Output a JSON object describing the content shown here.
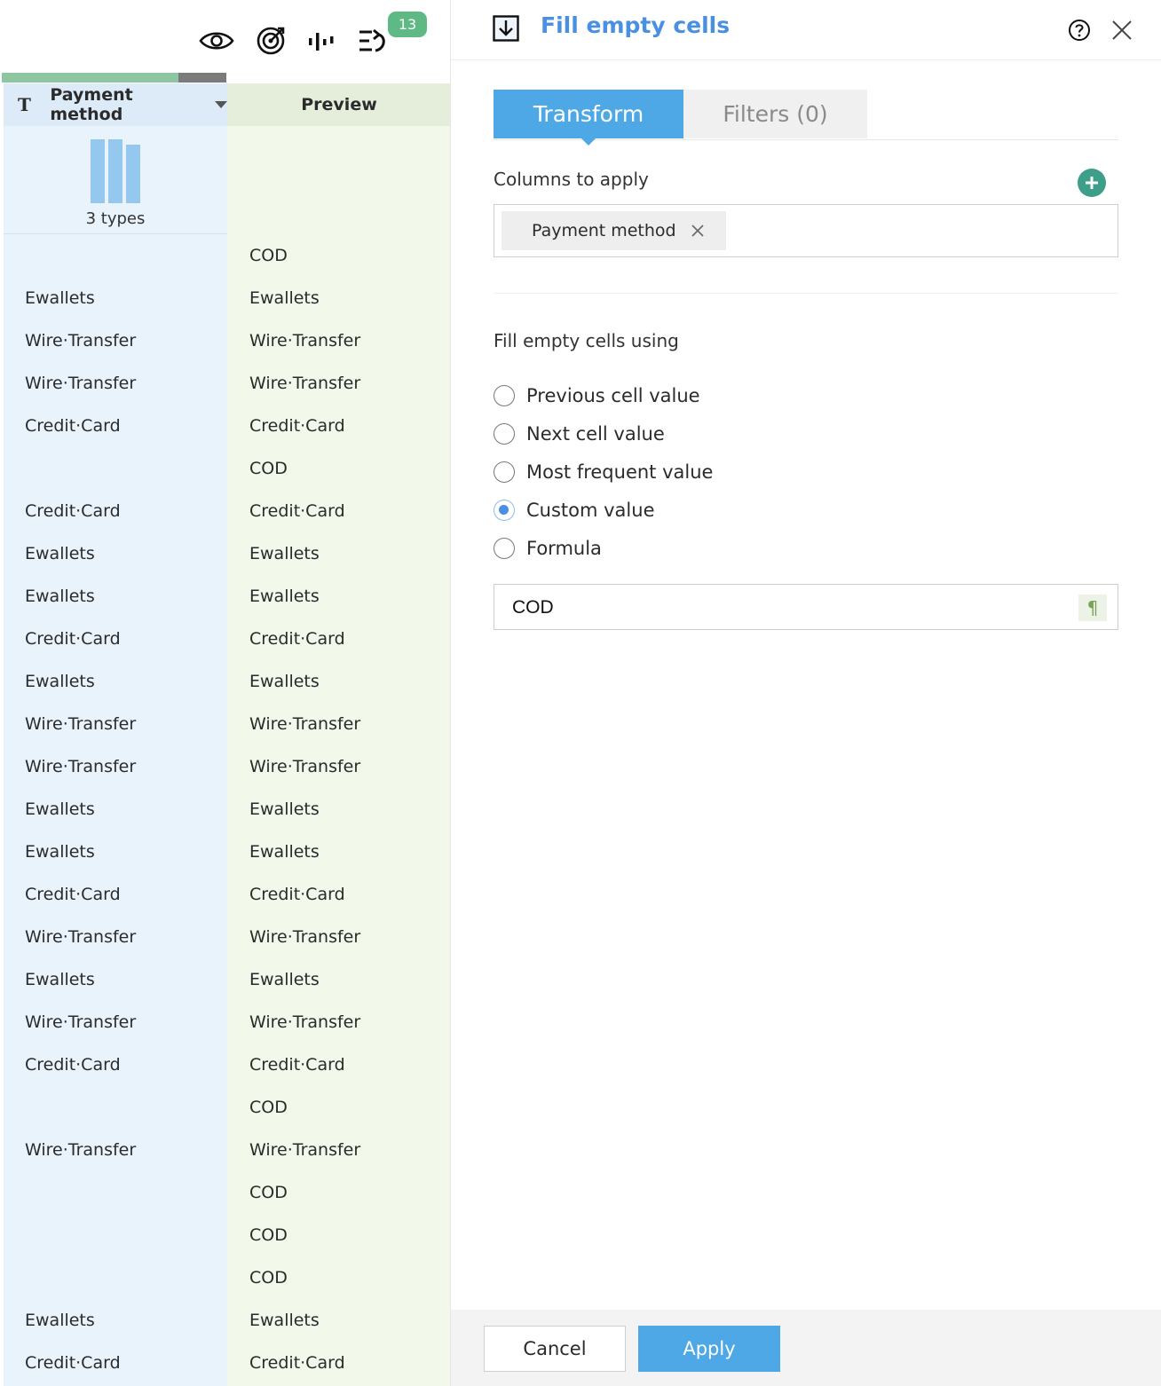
{
  "toolbar": {
    "icons": [
      "eye-icon",
      "target-icon",
      "chart-icon",
      "history-icon"
    ],
    "history_count": "13"
  },
  "grid": {
    "source_header": "Payment method",
    "source_type_icon": "T",
    "preview_header": "Preview",
    "profile_label": "3 types",
    "rows": [
      {
        "src": "",
        "prev": "COD"
      },
      {
        "src": "Ewallets",
        "prev": "Ewallets"
      },
      {
        "src": "Wire·Transfer",
        "prev": "Wire·Transfer"
      },
      {
        "src": "Wire·Transfer",
        "prev": "Wire·Transfer"
      },
      {
        "src": "Credit·Card",
        "prev": "Credit·Card"
      },
      {
        "src": "",
        "prev": "COD"
      },
      {
        "src": "Credit·Card",
        "prev": "Credit·Card"
      },
      {
        "src": "Ewallets",
        "prev": "Ewallets"
      },
      {
        "src": "Ewallets",
        "prev": "Ewallets"
      },
      {
        "src": "Credit·Card",
        "prev": "Credit·Card"
      },
      {
        "src": "Ewallets",
        "prev": "Ewallets"
      },
      {
        "src": "Wire·Transfer",
        "prev": "Wire·Transfer"
      },
      {
        "src": "Wire·Transfer",
        "prev": "Wire·Transfer"
      },
      {
        "src": "Ewallets",
        "prev": "Ewallets"
      },
      {
        "src": "Ewallets",
        "prev": "Ewallets"
      },
      {
        "src": "Credit·Card",
        "prev": "Credit·Card"
      },
      {
        "src": "Wire·Transfer",
        "prev": "Wire·Transfer"
      },
      {
        "src": "Ewallets",
        "prev": "Ewallets"
      },
      {
        "src": "Wire·Transfer",
        "prev": "Wire·Transfer"
      },
      {
        "src": "Credit·Card",
        "prev": "Credit·Card"
      },
      {
        "src": "",
        "prev": "COD"
      },
      {
        "src": "Wire·Transfer",
        "prev": "Wire·Transfer"
      },
      {
        "src": "",
        "prev": "COD"
      },
      {
        "src": "",
        "prev": "COD"
      },
      {
        "src": "",
        "prev": "COD"
      },
      {
        "src": "Ewallets",
        "prev": "Ewallets"
      },
      {
        "src": "Credit·Card",
        "prev": "Credit·Card"
      }
    ]
  },
  "panel": {
    "title": "Fill empty cells",
    "tabs": {
      "transform": "Transform",
      "filters": "Filters (0)"
    },
    "columns_label": "Columns to apply",
    "selected_column": "Payment method",
    "fill_label": "Fill empty cells using",
    "options": [
      {
        "label": "Previous cell value",
        "selected": false
      },
      {
        "label": "Next cell value",
        "selected": false
      },
      {
        "label": "Most frequent value",
        "selected": false
      },
      {
        "label": "Custom value",
        "selected": true
      },
      {
        "label": "Formula",
        "selected": false
      }
    ],
    "custom_value": "COD",
    "cancel_label": "Cancel",
    "apply_label": "Apply"
  },
  "colors": {
    "accent": "#4a90e2",
    "tab_active": "#4fa8e6",
    "badge": "#5fb985",
    "add_button": "#3d9e8a"
  }
}
